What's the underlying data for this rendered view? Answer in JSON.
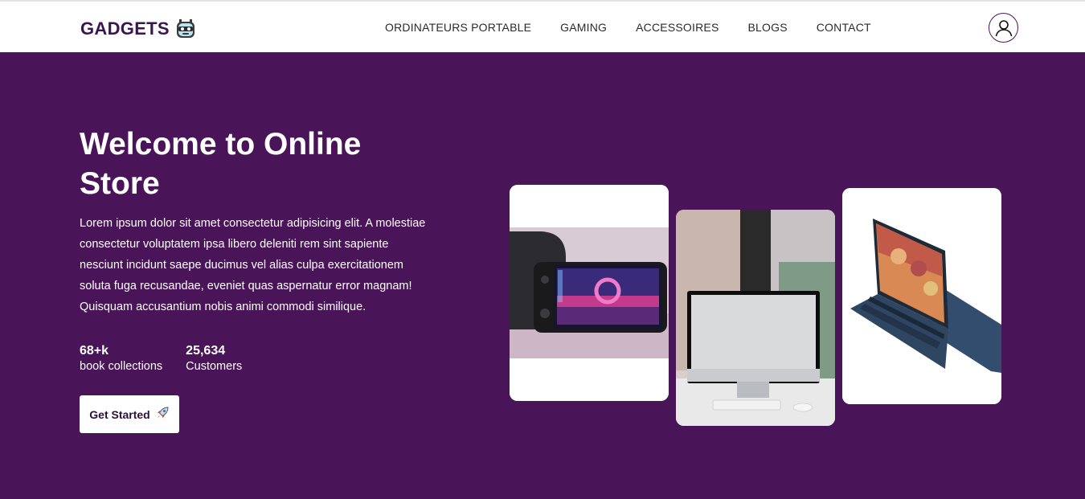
{
  "header": {
    "brand": "GADGETS",
    "brand_icon": "robot-face-icon",
    "nav": [
      "ORDINATEURS PORTABLE",
      "GAMING",
      "ACCESSOIRES",
      "BLOGS",
      "CONTACT"
    ],
    "account_icon": "user-avatar-icon"
  },
  "hero": {
    "title": "Welcome to Online Store",
    "description": "Lorem ipsum dolor sit amet consectetur adipisicing elit. A molestiae consectetur voluptatem ipsa libero deleniti rem sint sapiente nesciunt incidunt saepe ducimus vel alias culpa exercitationem soluta fuga recusandae, eveniet quas aspernatur error magnam! Quisquam accusantium nobis animi commodi similique.",
    "stats": [
      {
        "value": "68+k",
        "label": "book collections"
      },
      {
        "value": "25,634",
        "label": "Customers"
      }
    ],
    "cta": {
      "label": "Get Started",
      "icon": "rocket-icon"
    },
    "products": [
      "handheld-console-image",
      "imac-desktop-image",
      "laptop-image"
    ]
  },
  "colors": {
    "primary": "#4a1458",
    "brand_text": "#3a1550",
    "white": "#ffffff"
  }
}
